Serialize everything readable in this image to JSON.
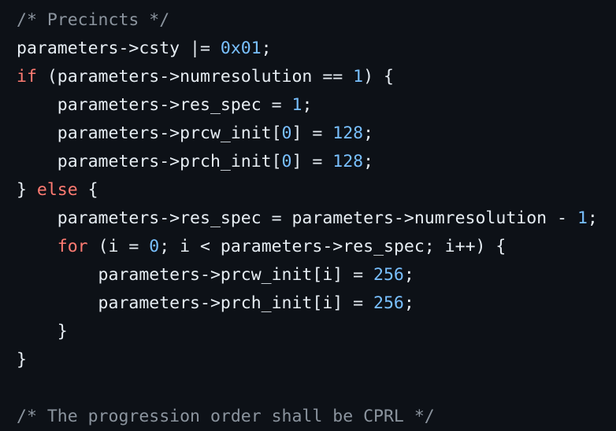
{
  "colors": {
    "background": "#0d1117",
    "text": "#e6edf3",
    "comment": "#8b949e",
    "keyword": "#ff7b72",
    "number": "#79c0ff"
  },
  "lines": [
    [
      {
        "t": "comment",
        "v": "/* Precincts */"
      }
    ],
    [
      {
        "t": "plain",
        "v": "parameters->csty |= "
      },
      {
        "t": "number",
        "v": "0x01"
      },
      {
        "t": "plain",
        "v": ";"
      }
    ],
    [
      {
        "t": "keyword",
        "v": "if"
      },
      {
        "t": "plain",
        "v": " (parameters->numresolution == "
      },
      {
        "t": "number",
        "v": "1"
      },
      {
        "t": "plain",
        "v": ") {"
      }
    ],
    [
      {
        "t": "plain",
        "v": "    parameters->res_spec = "
      },
      {
        "t": "number",
        "v": "1"
      },
      {
        "t": "plain",
        "v": ";"
      }
    ],
    [
      {
        "t": "plain",
        "v": "    parameters->prcw_init["
      },
      {
        "t": "number",
        "v": "0"
      },
      {
        "t": "plain",
        "v": "] = "
      },
      {
        "t": "number",
        "v": "128"
      },
      {
        "t": "plain",
        "v": ";"
      }
    ],
    [
      {
        "t": "plain",
        "v": "    parameters->prch_init["
      },
      {
        "t": "number",
        "v": "0"
      },
      {
        "t": "plain",
        "v": "] = "
      },
      {
        "t": "number",
        "v": "128"
      },
      {
        "t": "plain",
        "v": ";"
      }
    ],
    [
      {
        "t": "plain",
        "v": "} "
      },
      {
        "t": "keyword",
        "v": "else"
      },
      {
        "t": "plain",
        "v": " {"
      }
    ],
    [
      {
        "t": "plain",
        "v": "    parameters->res_spec = parameters->numresolution - "
      },
      {
        "t": "number",
        "v": "1"
      },
      {
        "t": "plain",
        "v": ";"
      }
    ],
    [
      {
        "t": "plain",
        "v": "    "
      },
      {
        "t": "keyword",
        "v": "for"
      },
      {
        "t": "plain",
        "v": " (i = "
      },
      {
        "t": "number",
        "v": "0"
      },
      {
        "t": "plain",
        "v": "; i < parameters->res_spec; i++) {"
      }
    ],
    [
      {
        "t": "plain",
        "v": "        parameters->prcw_init[i] = "
      },
      {
        "t": "number",
        "v": "256"
      },
      {
        "t": "plain",
        "v": ";"
      }
    ],
    [
      {
        "t": "plain",
        "v": "        parameters->prch_init[i] = "
      },
      {
        "t": "number",
        "v": "256"
      },
      {
        "t": "plain",
        "v": ";"
      }
    ],
    [
      {
        "t": "plain",
        "v": "    }"
      }
    ],
    [
      {
        "t": "plain",
        "v": "}"
      }
    ],
    [],
    [
      {
        "t": "comment",
        "v": "/* The progression order shall be CPRL */"
      }
    ]
  ]
}
